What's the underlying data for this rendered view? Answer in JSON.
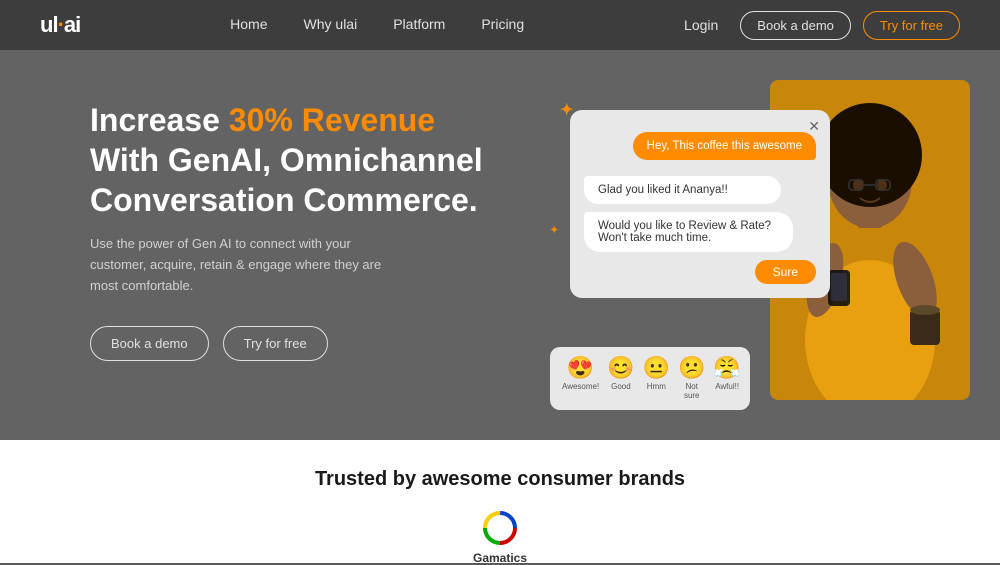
{
  "brand": {
    "name": "ul·ai",
    "logo_text": "ul",
    "logo_dot": "·",
    "logo_ai": "ai"
  },
  "nav": {
    "links": [
      {
        "label": "Home",
        "href": "#"
      },
      {
        "label": "Why ulai",
        "href": "#"
      },
      {
        "label": "Platform",
        "href": "#"
      },
      {
        "label": "Pricing",
        "href": "#"
      }
    ],
    "login_label": "Login",
    "book_demo_label": "Book a demo",
    "try_free_label": "Try for free"
  },
  "hero": {
    "title_prefix": "Increase ",
    "title_highlight": "30% Revenue",
    "title_suffix": "With GenAI, Omnichannel\nConversation Commerce.",
    "subtitle": "Use the power of Gen AI to connect with your customer, acquire, retain & engage where they are most comfortable.",
    "btn_demo": "Book a demo",
    "btn_try": "Try for free",
    "chat": {
      "msg1": "Hey, This coffee this awesome",
      "msg2": "Glad you liked it Ananya!!",
      "msg3": "Would you like to Review & Rate? Won't take much time.",
      "sure_btn": "Sure"
    },
    "ratings": [
      {
        "emoji": "😍",
        "label": "Awesome!"
      },
      {
        "emoji": "😊",
        "label": "Good"
      },
      {
        "emoji": "😐",
        "label": "Hmm"
      },
      {
        "emoji": "😕",
        "label": "Not sure"
      },
      {
        "emoji": "😤",
        "label": "Awful!!"
      }
    ],
    "stars": [
      "✦",
      "✦",
      "✦",
      "✦"
    ]
  },
  "trusted": {
    "title": "Trusted by awesome consumer brands",
    "logos": [
      {
        "name": "Gamatics",
        "type": "ring"
      }
    ]
  }
}
